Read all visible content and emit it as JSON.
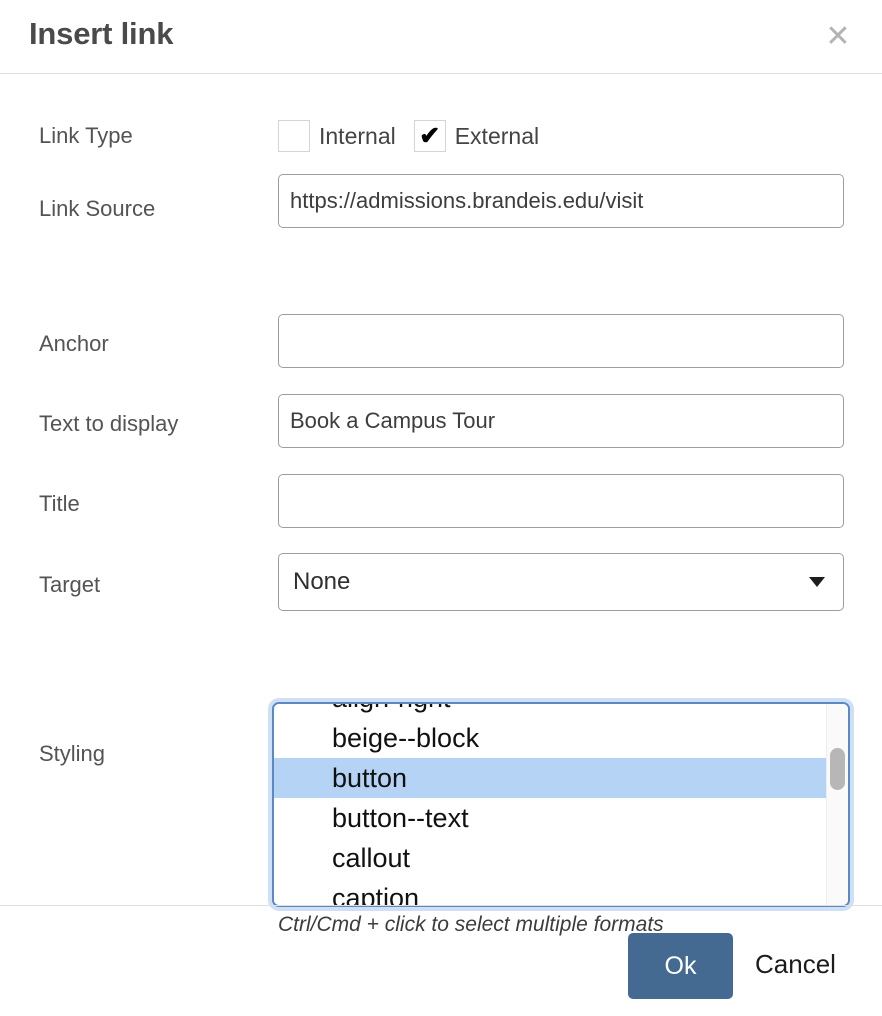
{
  "dialog": {
    "title": "Insert link",
    "close_icon": "close-icon"
  },
  "fields": {
    "link_type": {
      "label": "Link Type",
      "options": [
        {
          "label": "Internal",
          "checked": false
        },
        {
          "label": "External",
          "checked": true,
          "check_glyph": "✔"
        }
      ]
    },
    "link_source": {
      "label": "Link Source",
      "value": "https://admissions.brandeis.edu/visit",
      "placeholder": ""
    },
    "anchor": {
      "label": "Anchor",
      "value": "",
      "placeholder": ""
    },
    "text_to_display": {
      "label": "Text to display",
      "value": "Book a Campus Tour",
      "placeholder": ""
    },
    "title": {
      "label": "Title",
      "value": "",
      "placeholder": ""
    },
    "target": {
      "label": "Target",
      "value": "None",
      "arrow_icon": "chevron-down-icon"
    },
    "styling": {
      "label": "Styling",
      "hint": "Ctrl/Cmd + click to select multiple formats",
      "items": [
        {
          "label": "align-right",
          "selected": false
        },
        {
          "label": "beige--block",
          "selected": false
        },
        {
          "label": "button",
          "selected": true
        },
        {
          "label": "button--text",
          "selected": false
        },
        {
          "label": "callout",
          "selected": false
        },
        {
          "label": "caption",
          "selected": false
        }
      ]
    }
  },
  "footer": {
    "ok_label": "Ok",
    "cancel_label": "Cancel"
  },
  "colors": {
    "primary_button": "#456a91",
    "list_selection": "#b5d4f5",
    "focus_ring": "#cfe0f5",
    "focus_border": "#5b89c4",
    "divider": "#dcdfe3",
    "label_text": "#545454"
  }
}
